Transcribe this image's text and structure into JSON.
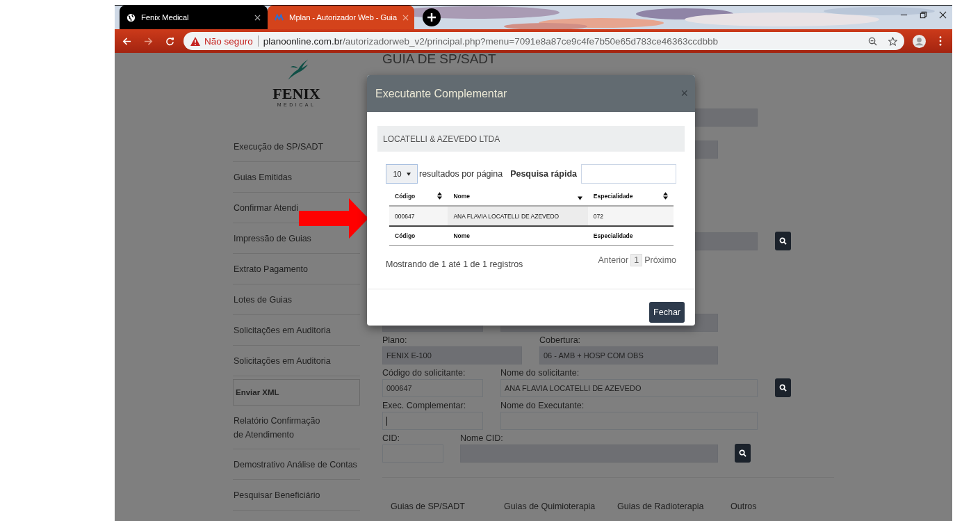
{
  "browser": {
    "tabs": [
      {
        "title": "Fenix Medical",
        "selected": false
      },
      {
        "title": "Mplan - Autorizador Web - Guia",
        "selected": true
      }
    ],
    "address": {
      "security": "Não seguro",
      "domain": "planoonline.com.br",
      "path": "/autorizadorweb_v2/principal.php?menu=7091e8a87ce9c4fe7b50e65d783ce46363ccdbbb"
    }
  },
  "page": {
    "logo": {
      "name": "FENIX",
      "tagline": "MEDICAL"
    },
    "sidebar": [
      {
        "label": "Execução de SP/SADT",
        "selected": false
      },
      {
        "label": "Guias Emitidas",
        "selected": false
      },
      {
        "label": "Confirmar Atendi",
        "selected": false
      },
      {
        "label": "Impressão de Guias",
        "selected": false
      },
      {
        "label": "Extrato Pagamento",
        "selected": false
      },
      {
        "label": "Lotes de Guias",
        "selected": false
      },
      {
        "label": "Solicitações em Auditoria",
        "selected": false
      },
      {
        "label": "Solicitações em Auditoria",
        "selected": false
      },
      {
        "label": "Enviar XML",
        "selected": true
      },
      {
        "label": "Relatório Confirmação\nde Atendimento",
        "selected": false
      },
      {
        "label": "Demostrativo Análise de Contas",
        "selected": false
      },
      {
        "label": "Pesquisar Beneficiário",
        "selected": false
      }
    ],
    "title": "GUIA DE SP/SADT",
    "form": [
      {
        "fields": [
          {
            "readonly": true
          }
        ]
      },
      {
        "fields": [
          {
            "readonly": true
          }
        ]
      },
      {
        "fields": [
          {
            "readonly": true
          }
        ],
        "search": true
      },
      {
        "fields": [
          {
            "readonly": true
          },
          {
            "readonly": true
          }
        ]
      },
      {
        "fields": [
          {
            "label": "Plano:",
            "value": "FENIX E-100",
            "readonly": true
          },
          {
            "label": "Cobertura:",
            "value": "06 - AMB + HOSP COM OBS",
            "readonly": true
          }
        ]
      },
      {
        "fields": [
          {
            "label": "Código do solicitante:",
            "value": "000647",
            "readonly": false
          },
          {
            "label": "Nome do solicitante:",
            "value": "ANA FLAVIA LOCATELLI DE AZEVEDO",
            "readonly": false
          }
        ],
        "search": true
      },
      {
        "fields": [
          {
            "label": "Exec. Complementar:",
            "readonly": false,
            "focused": true
          },
          {
            "label": "Nome do Executante:",
            "readonly": false
          }
        ]
      },
      {
        "fields": [
          {
            "label": "CID:",
            "readonly": false
          },
          {
            "label": "Nome CID:",
            "readonly": true
          }
        ],
        "search": true
      }
    ],
    "tabs": [
      {
        "label": "Guias de SP/SADT",
        "selected": false
      },
      {
        "label": "Guias de Quimioterapia",
        "selected": false
      },
      {
        "label": "Guias de Radioterapia",
        "selected": false
      },
      {
        "label": "Outros",
        "selected": false
      }
    ]
  },
  "modal": {
    "title": "Executante Complementar",
    "close": "×",
    "company": "LOCATELLI & AZEVEDO LTDA",
    "page_size": "10",
    "page_size_label": "resultados por página",
    "search_label": "Pesquisa rápida",
    "columns": [
      {
        "label": "Código",
        "sorted": false
      },
      {
        "label": "Nome",
        "sorted": true
      },
      {
        "label": "Especialidade",
        "sorted": false
      }
    ],
    "rows": [
      {
        "cells": [
          "000647",
          "ANA FLAVIA LOCATELLI DE AZEVEDO",
          "072"
        ]
      }
    ],
    "footer_columns": [
      "Código",
      "Nome",
      "Especialidade"
    ],
    "info": "Mostrando de 1 até 1 de 1 registros",
    "pagination": {
      "previous": "Anterior",
      "pages": [
        {
          "label": "1",
          "selected": true
        }
      ],
      "next": "Próximo"
    },
    "button": "Fechar"
  },
  "annotation": {
    "kind": "arrow"
  }
}
